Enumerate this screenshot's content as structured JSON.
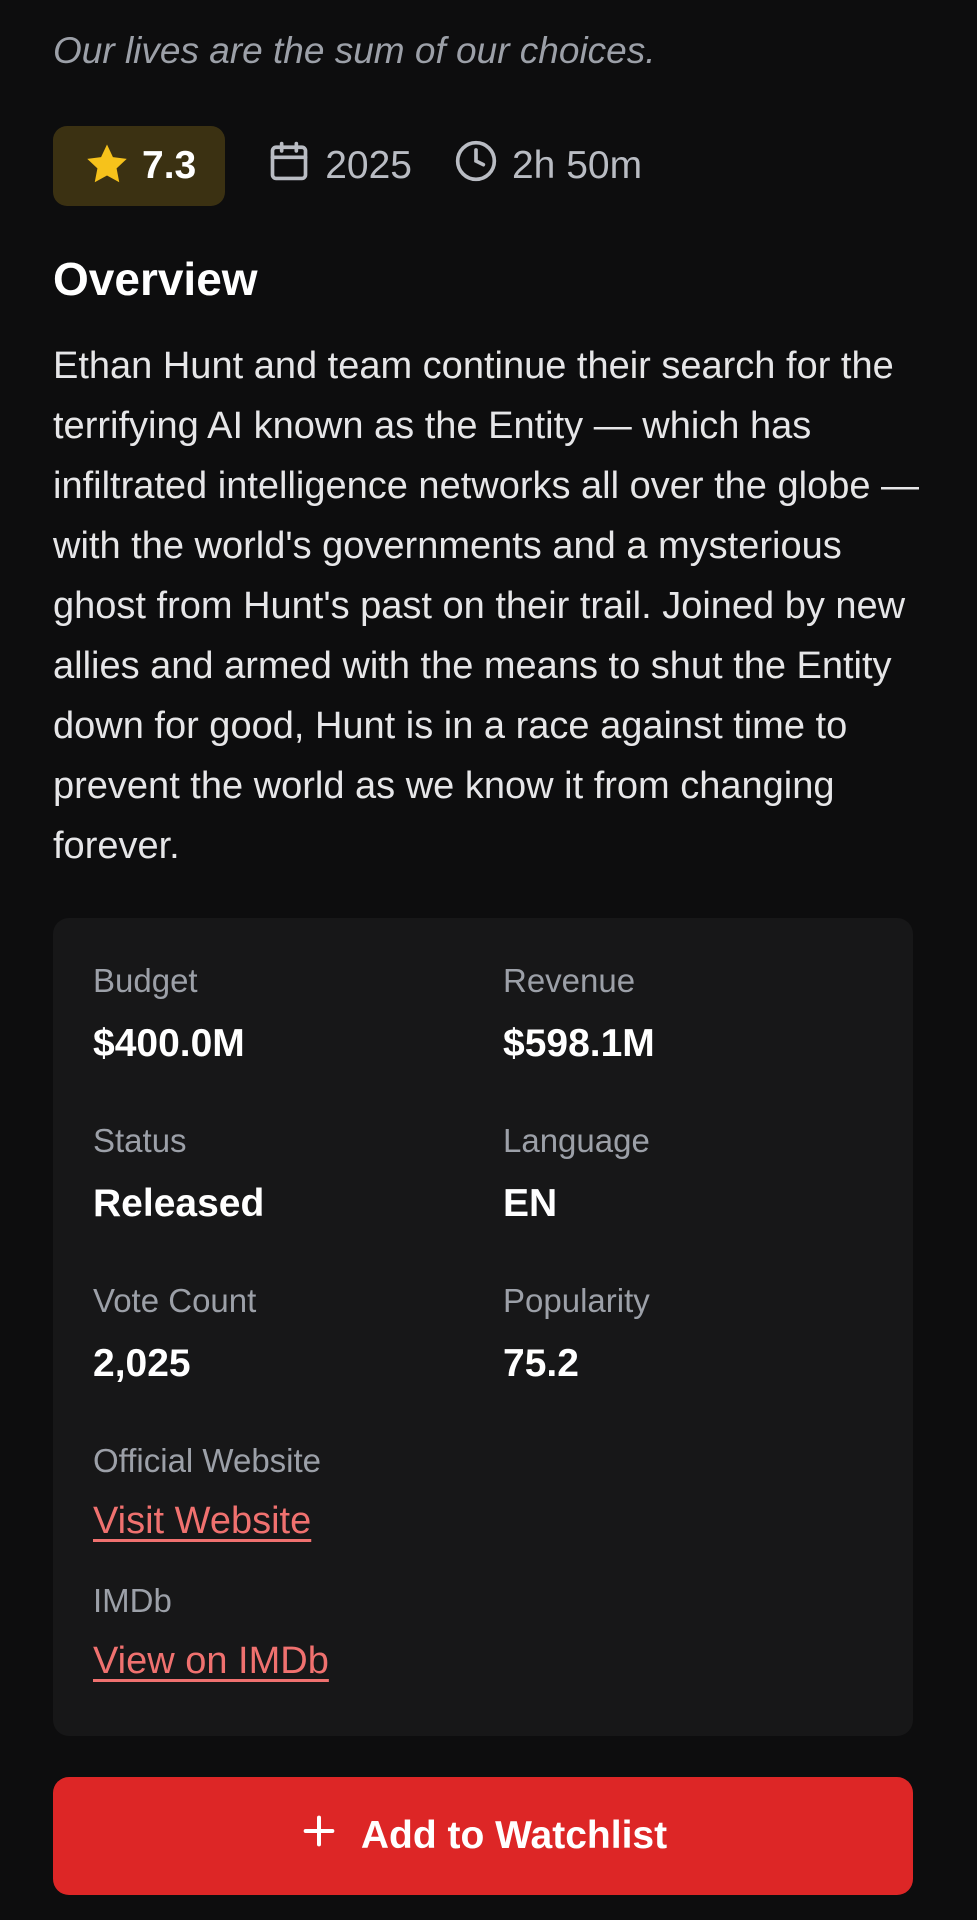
{
  "movie": {
    "tagline": "Our lives are the sum of our choices.",
    "rating": "7.3",
    "year": "2025",
    "runtime": "2h 50m"
  },
  "overview": {
    "heading": "Overview",
    "text": "Ethan Hunt and team continue their search for the terrifying AI known as the Entity — which has infiltrated intelligence networks all over the globe — with the world's governments and a mysterious ghost from Hunt's past on their trail. Joined by new allies and armed with the means to shut the Entity down for good, Hunt is in a race against time to prevent the world as we know it from changing forever."
  },
  "details": {
    "budget_label": "Budget",
    "budget_value": "$400.0M",
    "revenue_label": "Revenue",
    "revenue_value": "$598.1M",
    "status_label": "Status",
    "status_value": "Released",
    "language_label": "Language",
    "language_value": "EN",
    "vote_count_label": "Vote Count",
    "vote_count_value": "2,025",
    "popularity_label": "Popularity",
    "popularity_value": "75.2",
    "website_label": "Official Website",
    "website_link": "Visit Website",
    "imdb_label": "IMDb",
    "imdb_link": "View on IMDb"
  },
  "actions": {
    "watchlist_label": "Add to Watchlist"
  },
  "icons": {
    "rating": "star-icon",
    "year": "calendar-icon",
    "runtime": "clock-icon",
    "watchlist": "plus-icon"
  },
  "colors": {
    "background": "#0d0d0e",
    "card": "#171718",
    "accent": "#dd2626",
    "link": "#f0716f",
    "star": "#f6c21b",
    "rating_bg": "#3b3112"
  }
}
